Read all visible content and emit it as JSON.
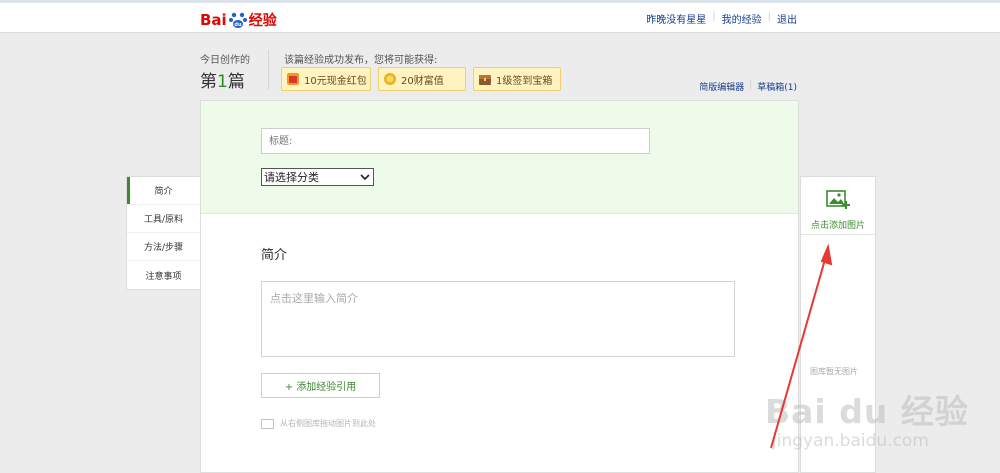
{
  "header": {
    "logo_text_a": "Bai",
    "logo_text_b": "经验",
    "links": [
      "昨晚没有星星",
      "我的经验",
      "退出"
    ]
  },
  "stats": {
    "today_label": "今日创作的",
    "today_prefix": "第",
    "today_count": "1",
    "today_suffix": "篇",
    "reward_label": "该篇经验成功发布，您将可能获得:",
    "rewards": [
      "10元现金红包",
      "20财富值",
      "1级签到宝箱"
    ]
  },
  "editor_links": [
    "简版编辑器",
    "草稿箱(1)"
  ],
  "form": {
    "title_placeholder": "标题:",
    "category_selected": "请选择分类",
    "section_title": "简介",
    "intro_placeholder": "点击这里输入简介",
    "add_reference": "+ 添加经验引用",
    "drag_hint": "从右侧图库拖动图片到此处"
  },
  "left_nav": {
    "items": [
      "简介",
      "工具/原料",
      "方法/步骤",
      "注意事项"
    ],
    "active": "简介"
  },
  "right_panel": {
    "add_image_label": "点击添加图片",
    "library_empty": "图库暂无图片"
  },
  "watermark": {
    "text": "Bai du 经验",
    "url": "jingyan.baidu.com"
  },
  "colors": {
    "accent_green": "#3c8b2e",
    "link_blue": "#1a3e8a",
    "brand_red": "#e10602",
    "annotation_red": "#e53935"
  }
}
